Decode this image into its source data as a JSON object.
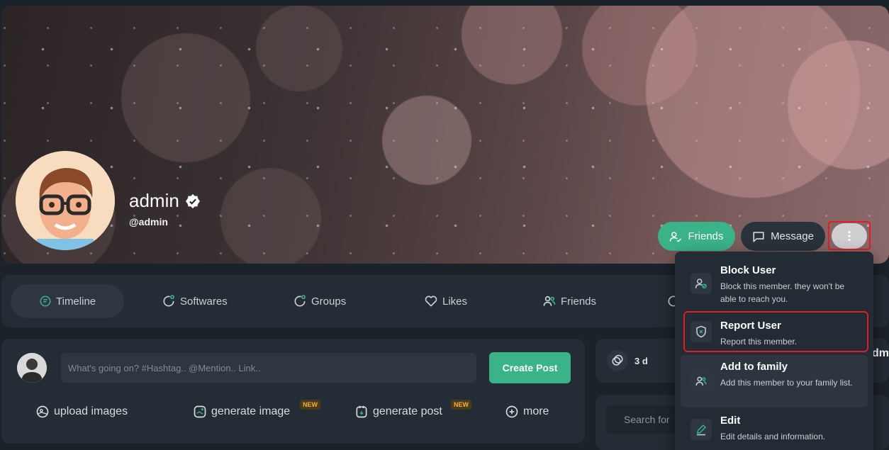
{
  "profile": {
    "name": "admin",
    "handle": "@admin"
  },
  "actions": {
    "friends_label": "Friends",
    "message_label": "Message"
  },
  "tabs": [
    {
      "label": "Timeline",
      "icon": "timeline-icon"
    },
    {
      "label": "Softwares",
      "icon": "softwares-icon"
    },
    {
      "label": "Groups",
      "icon": "groups-icon"
    },
    {
      "label": "Likes",
      "icon": "heart-icon"
    },
    {
      "label": "Friends",
      "icon": "friends-icon"
    }
  ],
  "composer": {
    "placeholder": "What's going on? #Hashtag.. @Mention.. Link..",
    "create_label": "Create Post",
    "actions": [
      {
        "label": "upload images",
        "icon": "image-upload-icon"
      },
      {
        "label": "generate image",
        "icon": "generate-image-icon",
        "badge": "NEW"
      },
      {
        "label": "generate post",
        "icon": "generate-post-icon",
        "badge": "NEW"
      },
      {
        "label": "more",
        "icon": "plus-circle-icon"
      }
    ]
  },
  "widgets": {
    "activity_label": "3 d",
    "search_placeholder": "Search for",
    "peek_text": "dm"
  },
  "dropdown": {
    "items": [
      {
        "title": "Block User",
        "desc": "Block this member. they won't be able to reach you."
      },
      {
        "title": "Report User",
        "desc": "Report this member."
      },
      {
        "title": "Add to family",
        "desc": "Add this member to your family list."
      },
      {
        "title": "Edit",
        "desc": "Edit details and information."
      }
    ]
  },
  "colors": {
    "accent": "#3bb389",
    "panel": "#242c35",
    "background": "#1b222a",
    "highlight": "#e11d2a",
    "badge": "#f2b03b"
  }
}
